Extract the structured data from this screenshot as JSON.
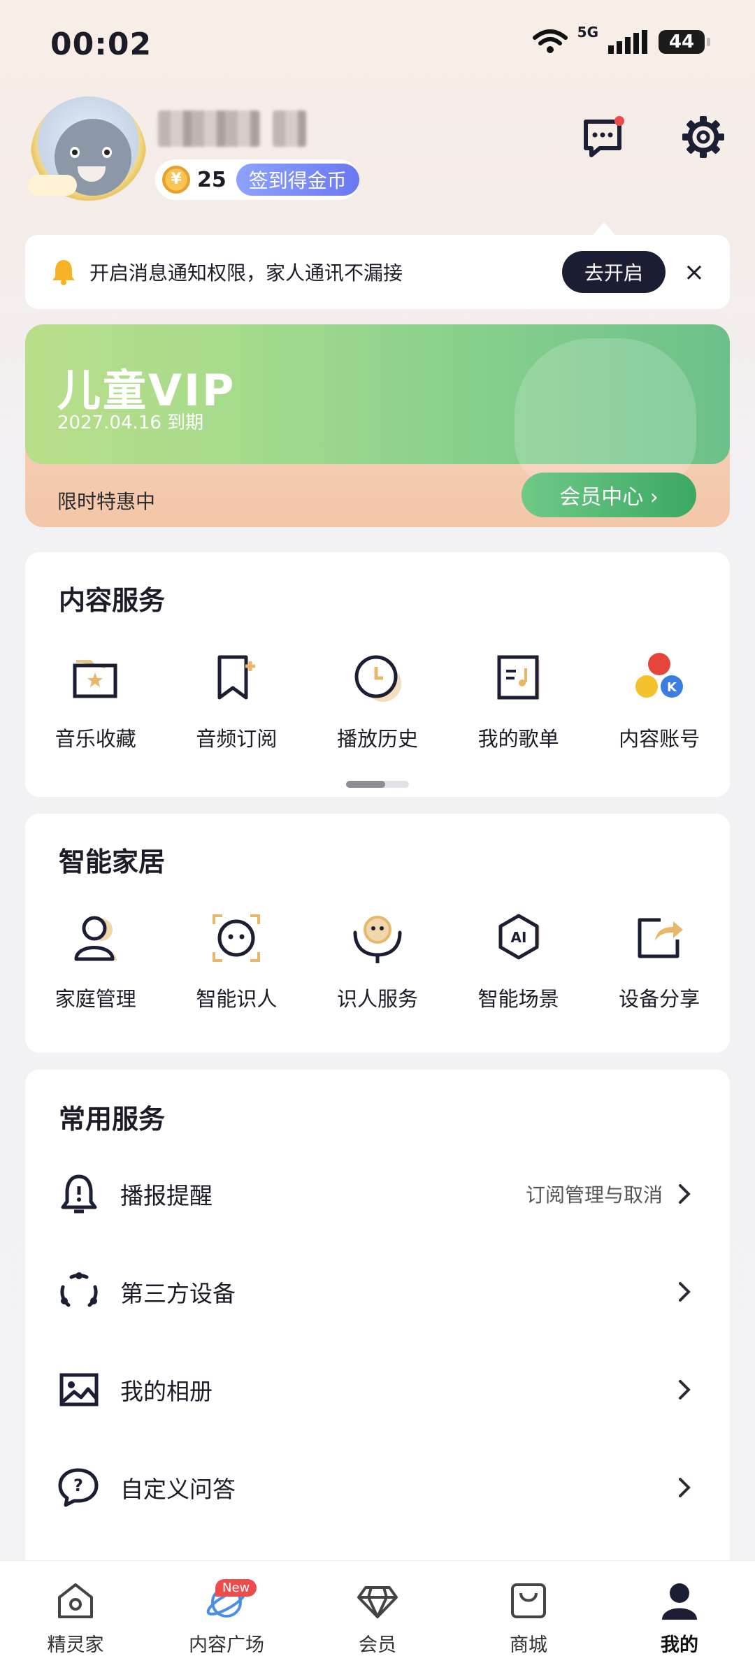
{
  "status_bar": {
    "time": "00:02",
    "network": "5G",
    "battery": "44"
  },
  "profile": {
    "coins": "25",
    "checkin_label": "签到得金币"
  },
  "notice": {
    "text": "开启消息通知权限，家人通讯不漏接",
    "button": "去开启",
    "close": "×"
  },
  "vip": {
    "title": "儿童VIP",
    "expire": "2027.04.16 到期",
    "deal": "限时特惠中",
    "button": "会员中心 ›"
  },
  "content_services": {
    "title": "内容服务",
    "items": [
      {
        "label": "音乐收藏",
        "icon": "music-favorites-icon"
      },
      {
        "label": "音频订阅",
        "icon": "audio-subscribe-icon"
      },
      {
        "label": "播放历史",
        "icon": "play-history-icon"
      },
      {
        "label": "我的歌单",
        "icon": "playlist-icon"
      },
      {
        "label": "内容账号",
        "icon": "content-account-icon"
      }
    ]
  },
  "smart_home": {
    "title": "智能家居",
    "items": [
      {
        "label": "家庭管理",
        "icon": "family-icon"
      },
      {
        "label": "智能识人",
        "icon": "face-recognition-icon"
      },
      {
        "label": "识人服务",
        "icon": "recognition-service-icon"
      },
      {
        "label": "智能场景",
        "icon": "ai-scene-icon"
      },
      {
        "label": "设备分享",
        "icon": "device-share-icon"
      }
    ]
  },
  "common_services": {
    "title": "常用服务",
    "rows": [
      {
        "label": "播报提醒",
        "hint": "订阅管理与取消",
        "icon": "bell-icon"
      },
      {
        "label": "第三方设备",
        "hint": "",
        "icon": "third-party-device-icon"
      },
      {
        "label": "我的相册",
        "hint": "",
        "icon": "album-icon"
      },
      {
        "label": "自定义问答",
        "hint": "",
        "icon": "custom-qa-icon"
      }
    ]
  },
  "bottom_nav": {
    "items": [
      {
        "label": "精灵家",
        "icon": "home-icon"
      },
      {
        "label": "内容广场",
        "icon": "content-plaza-icon",
        "badge": "New"
      },
      {
        "label": "会员",
        "icon": "diamond-icon"
      },
      {
        "label": "商城",
        "icon": "shop-bag-icon"
      },
      {
        "label": "我的",
        "icon": "profile-icon"
      }
    ]
  },
  "colors": {
    "accent_gold": "#e8b86a",
    "dark": "#1c1e33",
    "vip_green": "#3ba862"
  }
}
